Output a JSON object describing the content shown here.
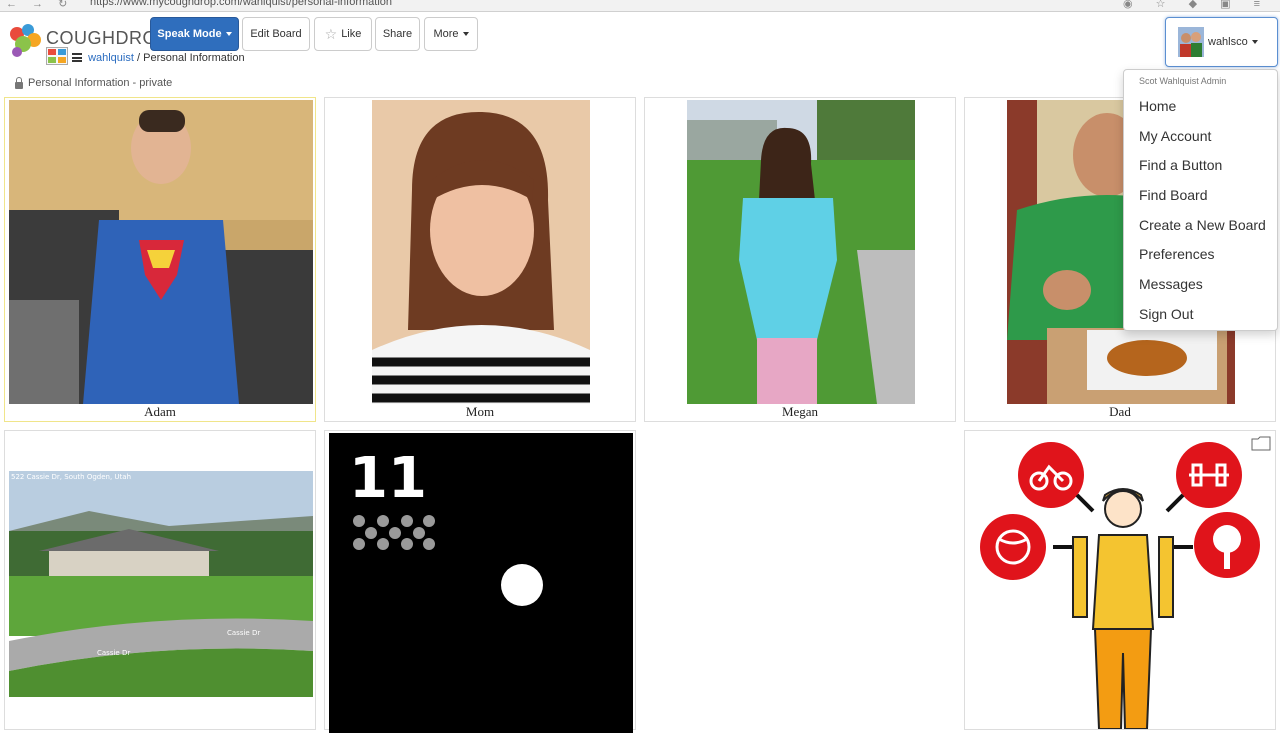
{
  "browser": {
    "url": "https://www.mycoughdrop.com/wahlquist/personal-information",
    "nav_glyphs": "← → ↻",
    "ext_glyphs": "◉ ☆ ◆ ▣ ≡"
  },
  "header": {
    "brand": "COUGHDROP",
    "speak_mode": "Speak Mode",
    "edit_board": "Edit Board",
    "like": "Like",
    "share": "Share",
    "more": "More",
    "user_name": "wahlsco"
  },
  "breadcrumb": {
    "user": "wahlquist",
    "separator": " / ",
    "board": "Personal Information"
  },
  "privacy": "Personal Information - private",
  "buttons": [
    {
      "label": "Adam"
    },
    {
      "label": "Mom"
    },
    {
      "label": "Megan"
    },
    {
      "label": "Dad"
    },
    {
      "label": ""
    },
    {
      "label": ""
    },
    {
      "label": ""
    },
    {
      "label": ""
    }
  ],
  "symbol_text": "11",
  "street_text": "522 Cassie Dr, South Ogden, Utah",
  "street_labels": [
    "Cassie Dr",
    "Cassie Dr"
  ],
  "dropdown": {
    "header": "Scot Wahlquist Admin",
    "items": [
      "Home",
      "My Account",
      "Find a Button",
      "Find Board",
      "Create a New Board",
      "Preferences",
      "Messages",
      "Sign Out"
    ]
  },
  "colors": {
    "primary": "#2f6ebd",
    "link": "#2a6cc0",
    "selected_border": "#f0e58a",
    "symbol_red": "#e0141b"
  }
}
